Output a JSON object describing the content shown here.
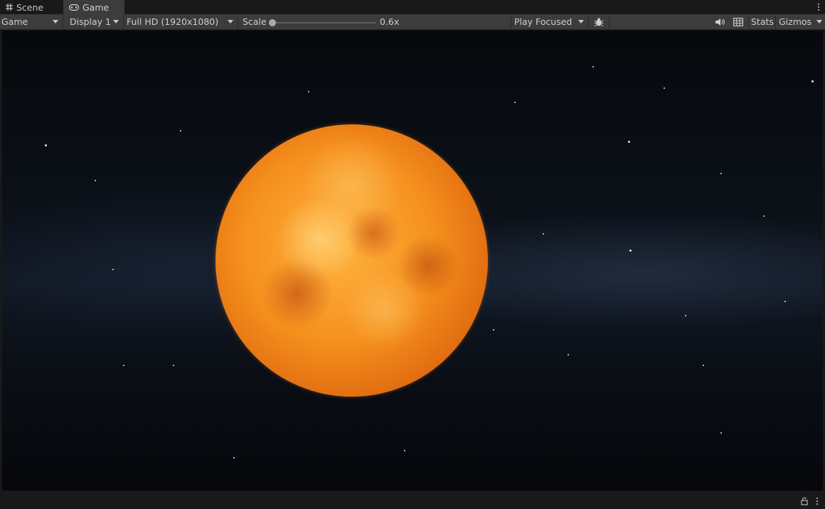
{
  "tabs": [
    {
      "label": "Scene",
      "icon": "grid-icon"
    },
    {
      "label": "Game",
      "icon": "gamepad-icon",
      "active": true
    }
  ],
  "toolbar": {
    "view_mode": "Game",
    "display": "Display 1",
    "resolution": "Full HD (1920x1080)",
    "scale_label": "Scale",
    "scale_value": "0.6x",
    "play_mode": "Play Focused",
    "stats_label": "Stats",
    "gizmos_label": "Gizmos"
  },
  "icons": {
    "mute": "speaker-icon",
    "debug": "bug-icon",
    "safe_area": "grid-layout-icon",
    "lock": "lock-icon",
    "menu": "kebab-menu-icon"
  },
  "colors": {
    "panel": "#3c3c3c",
    "background": "#191919",
    "text": "#c8c8c8",
    "sun_core": "#ffb340",
    "sun_edge": "#b84806"
  }
}
